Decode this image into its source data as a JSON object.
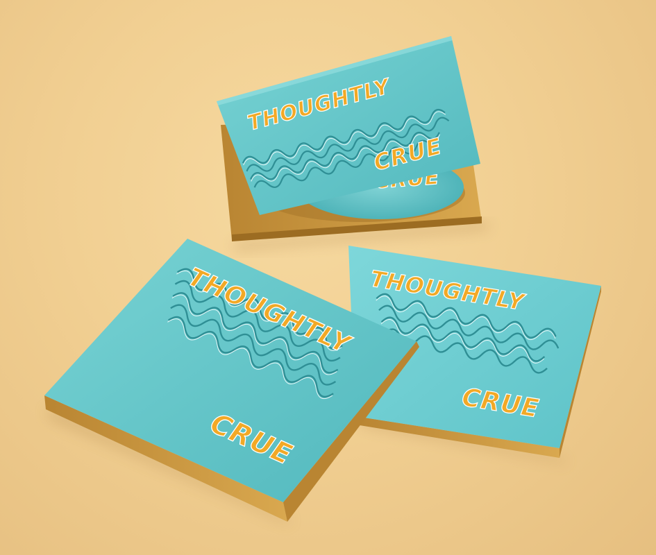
{
  "scene": {
    "description_free": true,
    "colors": {
      "background": "#f1cf92",
      "cover_teal": "#63c6c9",
      "cover_teal_dark": "#3fa6aa",
      "case_gold": "#c9963f",
      "case_gold_dark": "#a8772a",
      "title_orange": "#f2a926",
      "title_outline": "#ffffff",
      "wave_line": "#2f8f95"
    }
  },
  "albums": [
    {
      "title_top": "THOUGHTLY",
      "title_bottom": "CRUE",
      "disc_label": "CRUE"
    },
    {
      "title_top": "THOUGHTLY",
      "title_bottom": "CRUE"
    },
    {
      "title_top": "THOUGHTLY",
      "title_bottom": "CRUE"
    }
  ]
}
